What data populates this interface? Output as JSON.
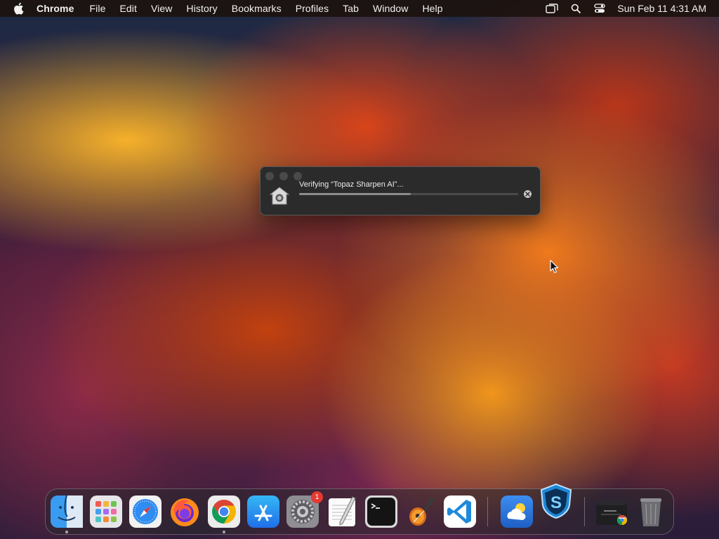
{
  "menubar": {
    "app_name": "Chrome",
    "menus": [
      "File",
      "Edit",
      "View",
      "History",
      "Bookmarks",
      "Profiles",
      "Tab",
      "Window",
      "Help"
    ],
    "clock": "Sun Feb 11  4:31 AM",
    "status_icons": [
      "screen-mirroring-icon",
      "spotlight-search-icon",
      "control-center-icon"
    ]
  },
  "dialog": {
    "title": "Verifying “Topaz Sharpen AI”...",
    "progress": 0.51,
    "icon": "installer-house-icon"
  },
  "dock": {
    "apps": [
      {
        "name": "Finder",
        "icon": "finder-icon",
        "running": true
      },
      {
        "name": "Launchpad",
        "icon": "launchpad-icon",
        "running": false
      },
      {
        "name": "Safari",
        "icon": "safari-icon",
        "running": false
      },
      {
        "name": "Firefox",
        "icon": "firefox-icon",
        "running": false
      },
      {
        "name": "Google Chrome",
        "icon": "chrome-icon",
        "running": true
      },
      {
        "name": "App Store",
        "icon": "app-store-icon",
        "running": false
      },
      {
        "name": "System Settings",
        "icon": "system-settings-icon",
        "running": false,
        "badge": "1"
      },
      {
        "name": "TextEdit",
        "icon": "textedit-icon",
        "running": false
      },
      {
        "name": "Terminal",
        "icon": "terminal-icon",
        "running": false
      },
      {
        "name": "GarageBand",
        "icon": "garageband-icon",
        "running": false
      },
      {
        "name": "Visual Studio Code",
        "icon": "vscode-icon",
        "running": false
      },
      {
        "name": "Weather",
        "icon": "weather-icon",
        "running": false
      },
      {
        "name": "Topaz Sharpen AI",
        "icon": "topaz-sharpen-icon",
        "running": false
      },
      {
        "name": "Downloads",
        "icon": "downloads-stack-icon",
        "running": false
      },
      {
        "name": "Trash",
        "icon": "trash-icon",
        "running": false
      }
    ]
  },
  "colors": {
    "menubar_bg": "#1c120e",
    "dialog_bg": "#2b2b2b",
    "badge": "#e63a32"
  }
}
